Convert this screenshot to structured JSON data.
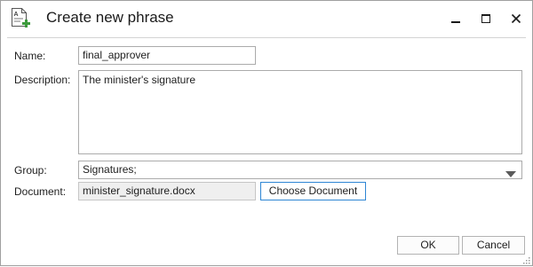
{
  "window": {
    "title": "Create new phrase",
    "icon": "phrase-document-add-icon",
    "controls": [
      "minimize-icon",
      "maximize-icon",
      "close-icon"
    ]
  },
  "form": {
    "name_label": "Name:",
    "name_value": "final_approver",
    "description_label": "Description:",
    "description_value": "The minister's signature",
    "group_label": "Group:",
    "group_value": "Signatures;",
    "document_label": "Document:",
    "document_value": "minister_signature.docx",
    "choose_document_label": "Choose Document"
  },
  "footer": {
    "ok_label": "OK",
    "cancel_label": "Cancel"
  },
  "colors": {
    "accent_border": "#2e86d4",
    "icon_green": "#3c9a3c",
    "field_border": "#ababab"
  }
}
